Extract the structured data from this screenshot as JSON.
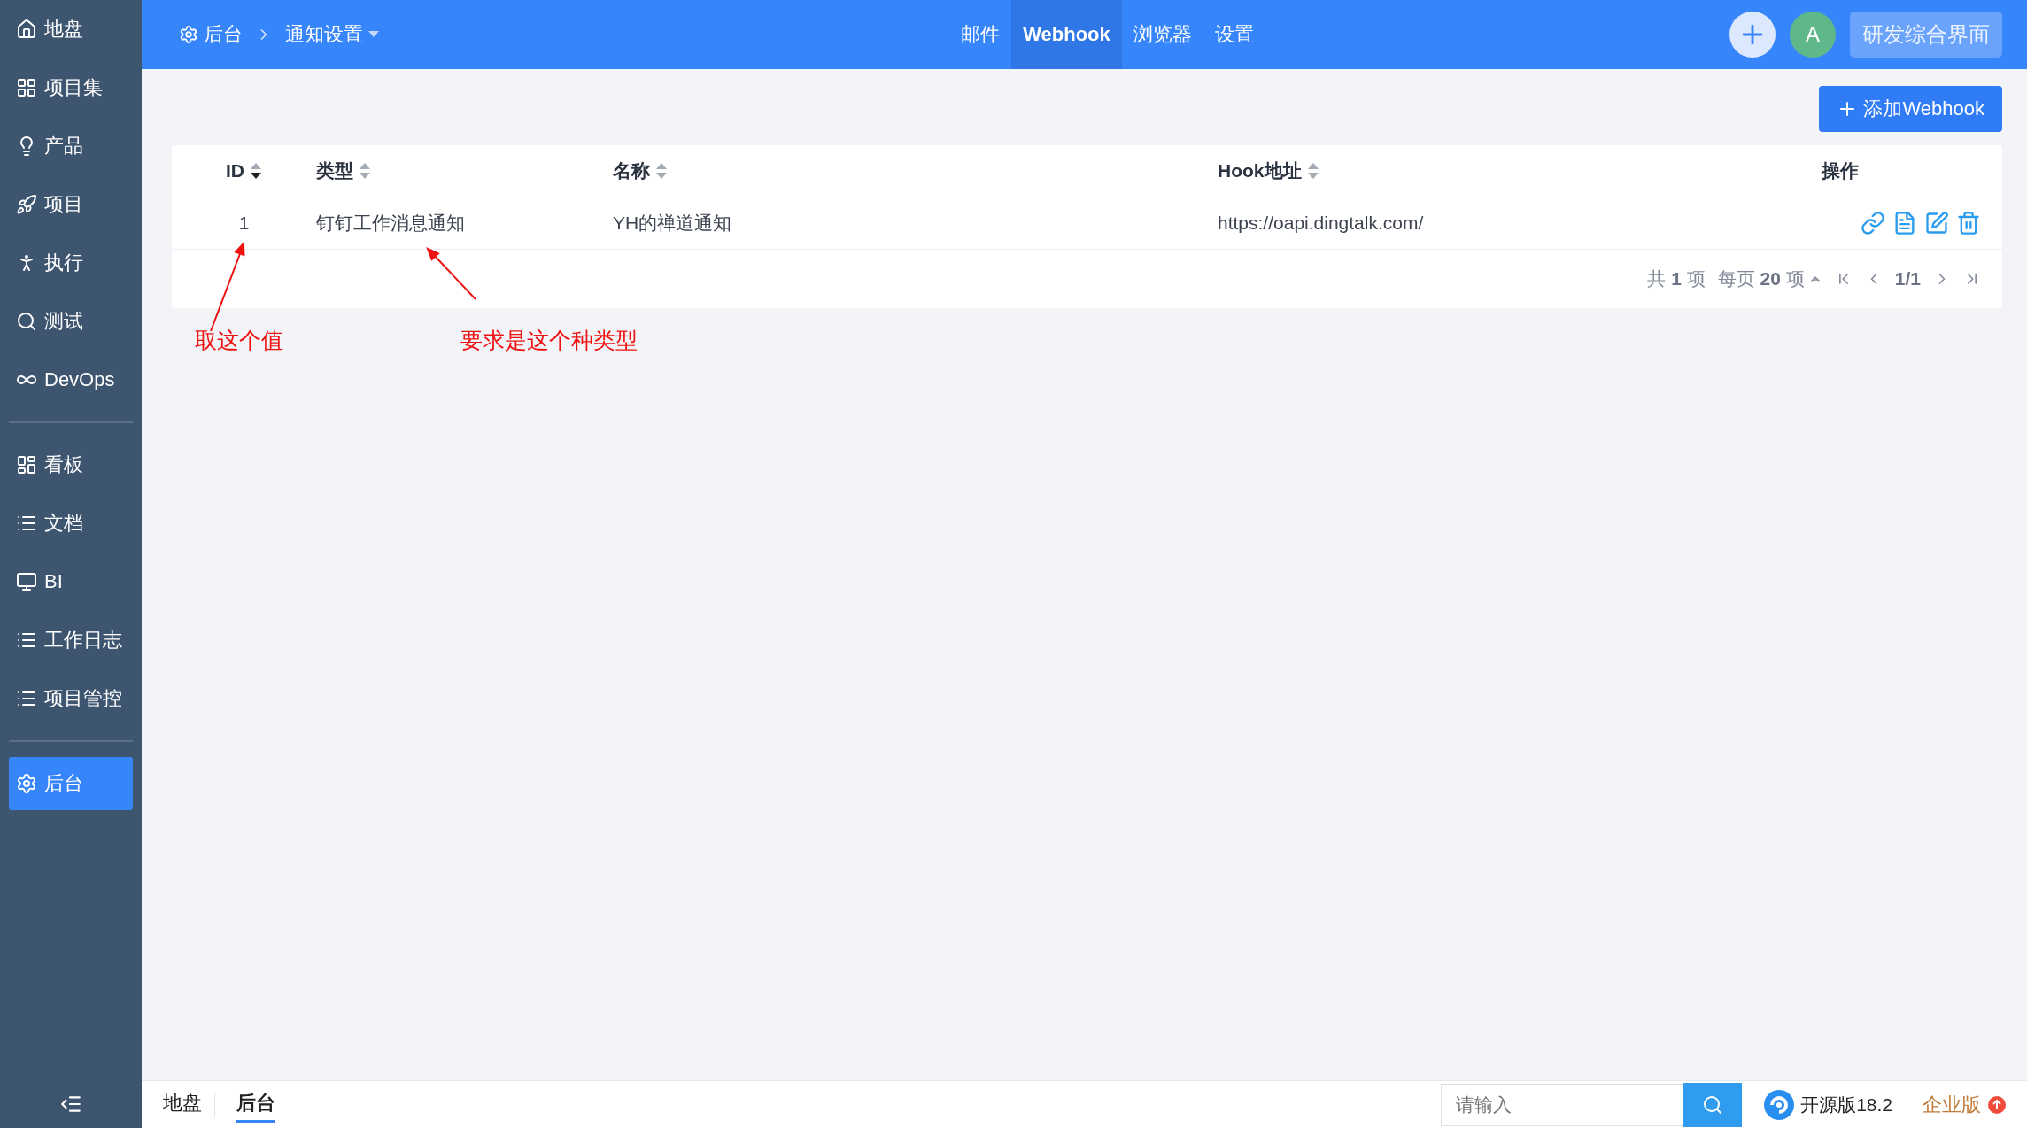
{
  "sidebar": {
    "groups": [
      [
        {
          "label": "地盘",
          "selected": false
        },
        {
          "label": "项目集",
          "selected": false
        },
        {
          "label": "产品",
          "selected": false
        },
        {
          "label": "项目",
          "selected": false
        },
        {
          "label": "执行",
          "selected": false
        },
        {
          "label": "测试",
          "selected": false
        },
        {
          "label": "DevOps",
          "selected": false
        }
      ],
      [
        {
          "label": "看板",
          "selected": false
        },
        {
          "label": "文档",
          "selected": false
        },
        {
          "label": "BI",
          "selected": false
        },
        {
          "label": "工作日志",
          "selected": false
        },
        {
          "label": "项目管控",
          "selected": false
        }
      ],
      [
        {
          "label": "后台",
          "selected": true
        }
      ]
    ]
  },
  "header": {
    "breadcrumb": [
      {
        "label": "后台",
        "dropdown": false
      },
      {
        "label": "通知设置",
        "dropdown": true
      }
    ],
    "tabs": [
      {
        "label": "邮件",
        "selected": false
      },
      {
        "label": "Webhook",
        "selected": true
      },
      {
        "label": "浏览器",
        "selected": false
      },
      {
        "label": "设置",
        "selected": false
      }
    ],
    "avatar": "A",
    "switch_button": "研发综合界面"
  },
  "add_button": "添加Webhook",
  "table": {
    "columns": [
      {
        "label": "ID",
        "sortable": true,
        "sorted_desc": true
      },
      {
        "label": "类型",
        "sortable": true,
        "sorted_desc": false
      },
      {
        "label": "名称",
        "sortable": true,
        "sorted_desc": false
      },
      {
        "label": "Hook地址",
        "sortable": true,
        "sorted_desc": false
      },
      {
        "label": "操作",
        "sortable": false
      }
    ],
    "rows": [
      {
        "cells": [
          "1",
          "钉钉工作消息通知",
          "YH的禅道通知",
          "https://oapi.dingtalk.com/"
        ]
      }
    ]
  },
  "pagination": {
    "total": "共 **1** 项",
    "per_page": "每页 **20** 项",
    "page": "1/1"
  },
  "annotations": [
    {
      "text": "取这个值"
    },
    {
      "text": "要求是这个种类型"
    }
  ],
  "footer": {
    "tabs": [
      {
        "label": "地盘",
        "selected": false
      },
      {
        "label": "后台",
        "selected": true
      }
    ],
    "search": {
      "placeholder": "请输入"
    },
    "version": "开源版18.2",
    "edition": "企业版"
  }
}
